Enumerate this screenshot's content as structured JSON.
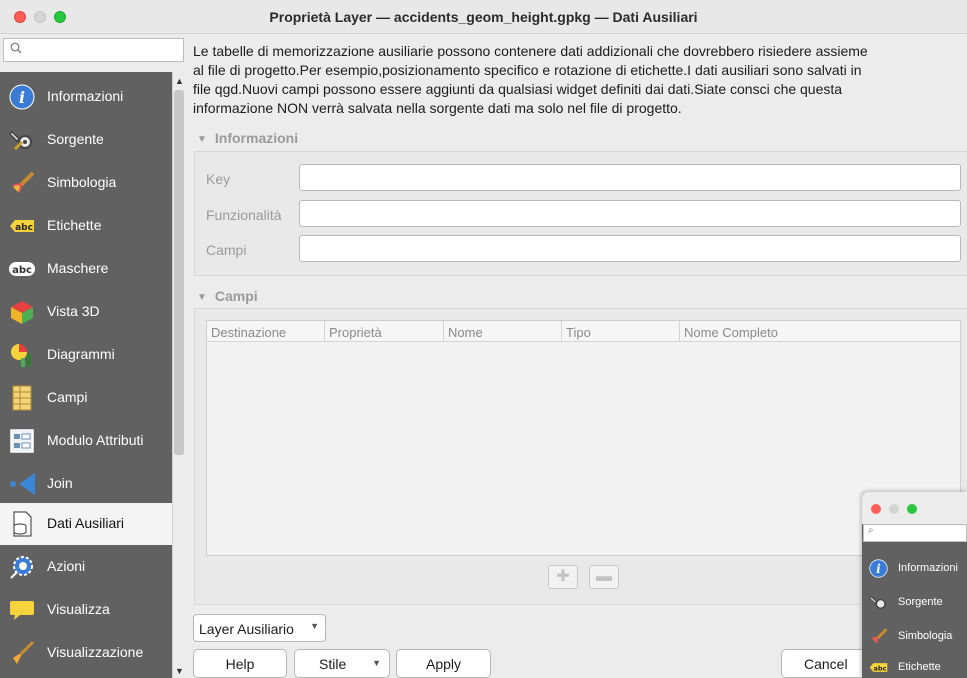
{
  "window": {
    "title": "Proprietà Layer — accidents_geom_height.gpkg — Dati Ausiliari"
  },
  "search": {
    "placeholder": ""
  },
  "sidebar": {
    "items": [
      {
        "label": "Informazioni",
        "icon": "info-icon"
      },
      {
        "label": "Sorgente",
        "icon": "source-tools-icon"
      },
      {
        "label": "Simbologia",
        "icon": "paintbrush-icon"
      },
      {
        "label": "Etichette",
        "icon": "abc-label-icon"
      },
      {
        "label": "Maschere",
        "icon": "abc-mask-icon"
      },
      {
        "label": "Vista 3D",
        "icon": "cube-3d-icon"
      },
      {
        "label": "Diagrammi",
        "icon": "diagram-icon"
      },
      {
        "label": "Campi",
        "icon": "fields-icon"
      },
      {
        "label": "Modulo Attributi",
        "icon": "attribute-form-icon"
      },
      {
        "label": "Join",
        "icon": "join-icon"
      },
      {
        "label": "Dati Ausiliari",
        "icon": "auxiliary-storage-icon",
        "selected": true
      },
      {
        "label": "Azioni",
        "icon": "actions-icon"
      },
      {
        "label": "Visualizza",
        "icon": "display-icon"
      },
      {
        "label": "Visualizzazione",
        "icon": "rendering-icon"
      }
    ]
  },
  "description": "Le tabelle di memorizzazione ausiliarie possono contenere dati addizionali che dovrebbero risiedere assieme\nal file di progetto.Per esempio,posizionamento specifico e rotazione di etichette.I dati ausiliari sono salvati in\nfile qgd.Nuovi campi possono essere aggiunti da qualsiasi widget definiti dai dati.Siate consci che questa\ninformazione NON verrà salvata nella sorgente dati ma solo nel file di progetto.",
  "info_group": {
    "title": "Informazioni",
    "fields": [
      {
        "label": "Key",
        "value": ""
      },
      {
        "label": "Funzionalità",
        "value": ""
      },
      {
        "label": "Campi",
        "value": ""
      }
    ]
  },
  "fields_group": {
    "title": "Campi",
    "columns": [
      "Destinazione",
      "Proprietà",
      "Nome",
      "Tipo",
      "Nome Completo"
    ],
    "rows": []
  },
  "buttons": {
    "layer": "Layer Ausiliario",
    "help": "Help",
    "style": "Stile",
    "apply": "Apply",
    "cancel": "Cancel"
  },
  "mini_window": {
    "items": [
      {
        "label": "Informazioni",
        "icon": "info-icon"
      },
      {
        "label": "Sorgente",
        "icon": "source-tools-icon"
      },
      {
        "label": "Simbologia",
        "icon": "paintbrush-icon"
      },
      {
        "label": "Etichette",
        "icon": "abc-label-icon"
      }
    ]
  },
  "colors": {
    "sidebar_bg": "#616161",
    "selected_bg": "#f4f4f4",
    "close": "#ff5f57",
    "zoom": "#28c840"
  }
}
